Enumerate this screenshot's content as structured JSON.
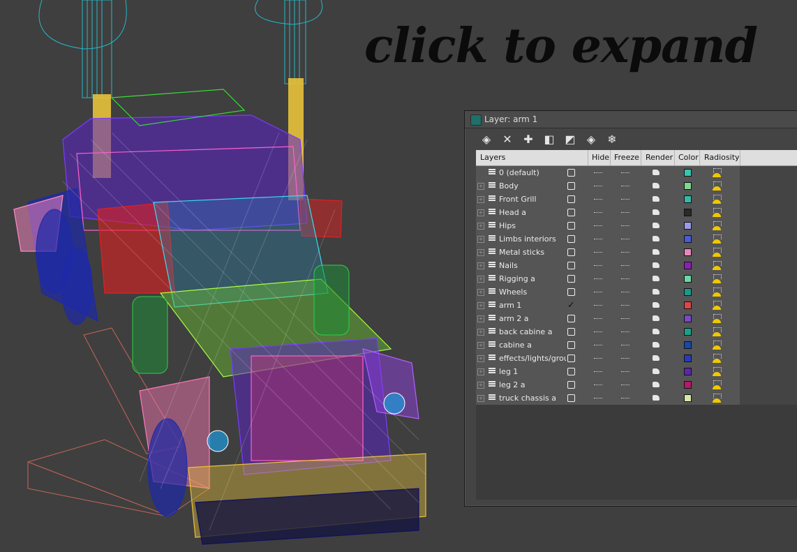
{
  "overlay": {
    "headline": "click to expand"
  },
  "window": {
    "title": "Layer: arm 1",
    "toolbar": [
      {
        "icon": "new-layer-icon",
        "glyph": "◈"
      },
      {
        "icon": "delete-icon",
        "glyph": "✕"
      },
      {
        "icon": "add-icon",
        "glyph": "✚"
      },
      {
        "icon": "select-highlight-icon",
        "glyph": "◧"
      },
      {
        "icon": "highlight-selected-icon",
        "glyph": "◩"
      },
      {
        "icon": "hide-all-icon",
        "glyph": "◈"
      },
      {
        "icon": "freeze-all-icon",
        "glyph": "❄"
      }
    ],
    "columns": {
      "layers": "Layers",
      "hide": "Hide",
      "freeze": "Freeze",
      "render": "Render",
      "color": "Color",
      "radiosity": "Radiosity"
    },
    "rows": [
      {
        "name": "0 (default)",
        "color": "#38c4b0",
        "expandable": false,
        "active": false
      },
      {
        "name": "Body",
        "color": "#7fd88f",
        "expandable": true,
        "active": false
      },
      {
        "name": "Front Grill",
        "color": "#35b8a8",
        "expandable": true,
        "active": false
      },
      {
        "name": "Head a",
        "color": "#2a2a2a",
        "expandable": true,
        "active": false
      },
      {
        "name": "Hips",
        "color": "#9a9ae8",
        "expandable": true,
        "active": false
      },
      {
        "name": "Limbs interiors",
        "color": "#4a5ad8",
        "expandable": true,
        "active": false
      },
      {
        "name": "Metal sticks",
        "color": "#e888b8",
        "expandable": true,
        "active": false
      },
      {
        "name": "Nails",
        "color": "#8a20b0",
        "expandable": true,
        "active": false
      },
      {
        "name": "Rigging a",
        "color": "#6ad8a8",
        "expandable": true,
        "active": false
      },
      {
        "name": "Wheels",
        "color": "#1a9a8a",
        "expandable": true,
        "active": false
      },
      {
        "name": "arm 1",
        "color": "#d84848",
        "expandable": true,
        "active": true
      },
      {
        "name": "arm 2 a",
        "color": "#7a48c8",
        "expandable": true,
        "active": false
      },
      {
        "name": "back cabine a",
        "color": "#1aa088",
        "expandable": true,
        "active": false
      },
      {
        "name": "cabine a",
        "color": "#1848a8",
        "expandable": true,
        "active": false
      },
      {
        "name": "effects/lights/groun",
        "color": "#2a3ab8",
        "expandable": true,
        "active": false
      },
      {
        "name": "leg 1",
        "color": "#5a28a8",
        "expandable": true,
        "active": false
      },
      {
        "name": "leg 2 a",
        "color": "#b81868",
        "expandable": true,
        "active": false
      },
      {
        "name": "truck chassis a",
        "color": "#d8e8a8",
        "expandable": true,
        "active": false
      }
    ]
  }
}
